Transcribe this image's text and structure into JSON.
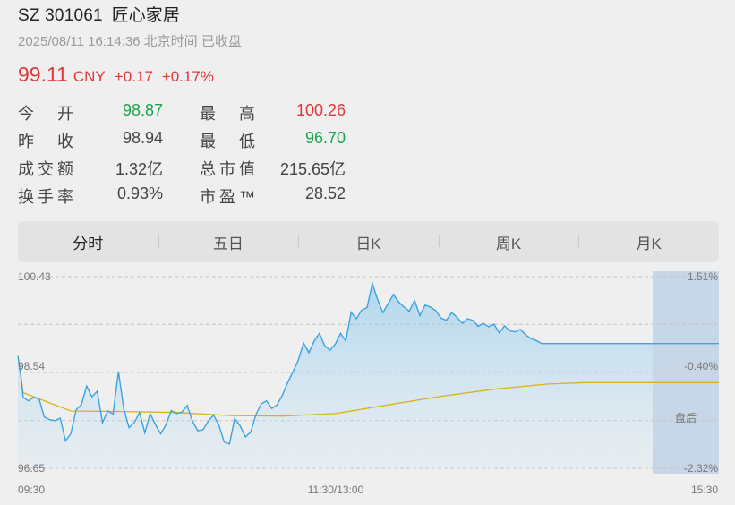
{
  "header": {
    "code": "SZ 301061",
    "name": "匠心家居",
    "timestamp": "2025/08/11 16:14:36 北京时间 已收盘"
  },
  "quote": {
    "price": "99.11",
    "currency": "CNY",
    "change": "+0.17",
    "change_pct": "+0.17%"
  },
  "stats": [
    {
      "l1": "今开",
      "v1": "98.87",
      "c1": "green",
      "l2": "最高",
      "v2": "100.26",
      "c2": "red"
    },
    {
      "l1": "昨收",
      "v1": "98.94",
      "c1": "dark",
      "l2": "最低",
      "v2": "96.70",
      "c2": "green"
    },
    {
      "l1": "成交额",
      "v1": "1.32亿",
      "c1": "dark",
      "l2": "总市值",
      "v2": "215.65亿",
      "c2": "dark"
    },
    {
      "l1": "换手率",
      "v1": "0.93%",
      "c1": "dark",
      "l2": "市盈™",
      "v2": "28.52",
      "c2": "dark"
    }
  ],
  "tabs": [
    "分时",
    "五日",
    "日K",
    "周K",
    "月K"
  ],
  "active_tab": 0,
  "colors": {
    "up": "#e0363a",
    "down": "#1aa34a",
    "price_line": "#3aa3e3",
    "avg_line": "#d9b21a",
    "after_hours": "#b8cde6"
  },
  "chart_data": {
    "type": "line",
    "ylim": [
      96.65,
      100.43
    ],
    "y_ticks_left": [
      "100.43",
      "98.54",
      "96.65"
    ],
    "y_ticks_right": [
      "1.51%",
      "-0.40%",
      "-2.32%"
    ],
    "x_ticks": [
      "09:30",
      "11:30/13:00",
      "15:30"
    ],
    "after_hours_label": "盘后",
    "series": [
      {
        "type": "line",
        "minutes": [
          0,
          1,
          2,
          4,
          6,
          8,
          10,
          12,
          14,
          16,
          18,
          20,
          22,
          24,
          26,
          28,
          30,
          32,
          34,
          36,
          38,
          40,
          42,
          44,
          46,
          48,
          50,
          52,
          54,
          56,
          58,
          60,
          62,
          64,
          66,
          68,
          70,
          72,
          74,
          76,
          78,
          80,
          82,
          84,
          86,
          88,
          90,
          92,
          94,
          96,
          98,
          100,
          102,
          104,
          106,
          108,
          110,
          112,
          114,
          116,
          118,
          120,
          122,
          124,
          126,
          128,
          130,
          132,
          134,
          136,
          138,
          140,
          142,
          144,
          146,
          148,
          150,
          152,
          154,
          156,
          158,
          160,
          162,
          164,
          166,
          168,
          170,
          172,
          174,
          176,
          178,
          180,
          182,
          184,
          186,
          188,
          190,
          192,
          194,
          196,
          198,
          200,
          202,
          204,
          206,
          208,
          210,
          212,
          214,
          216,
          218,
          220,
          222,
          224,
          226,
          228,
          230,
          232,
          234,
          236,
          238,
          240
        ],
        "values": [
          98.86,
          98.53,
          98.05,
          97.98,
          98.05,
          98.02,
          97.66,
          97.61,
          97.59,
          97.64,
          97.19,
          97.33,
          97.8,
          97.91,
          98.27,
          98.06,
          98.17,
          97.55,
          97.78,
          97.72,
          98.56,
          97.83,
          97.45,
          97.55,
          97.75,
          97.35,
          97.73,
          97.51,
          97.33,
          97.51,
          97.79,
          97.73,
          97.76,
          97.89,
          97.58,
          97.39,
          97.41,
          97.58,
          97.7,
          97.5,
          97.17,
          97.13,
          97.63,
          97.49,
          97.27,
          97.36,
          97.71,
          97.92,
          97.98,
          97.83,
          97.9,
          98.09,
          98.34,
          98.55,
          98.78,
          99.12,
          98.93,
          99.16,
          99.31,
          99.07,
          98.98,
          99.1,
          99.31,
          99.16,
          99.73,
          99.6,
          99.77,
          99.82,
          100.3,
          99.98,
          99.72,
          99.9,
          100.08,
          99.93,
          99.83,
          99.75,
          99.96,
          99.66,
          99.87,
          99.83,
          99.76,
          99.61,
          99.57,
          99.72,
          99.63,
          99.51,
          99.6,
          99.57,
          99.45,
          99.51,
          99.44,
          99.49,
          99.32,
          99.46,
          99.36,
          99.34,
          99.39,
          99.28,
          99.21,
          99.17,
          99.11,
          99.11,
          99.11,
          99.11,
          99.11,
          99.11,
          99.11,
          99.11,
          99.11,
          99.11,
          99.11,
          99.11,
          99.11,
          99.11,
          99.11,
          99.11,
          99.11,
          99.11,
          99.11,
          99.11,
          99.11,
          99.11
        ]
      },
      {
        "type": "line",
        "minutes": [
          0,
          2,
          20,
          40,
          60,
          80,
          100,
          120,
          140,
          160,
          180,
          200,
          215,
          240
        ],
        "values": [
          98.87,
          98.14,
          97.78,
          97.77,
          97.75,
          97.69,
          97.68,
          97.73,
          97.9,
          98.07,
          98.21,
          98.31,
          98.34,
          98.34
        ]
      }
    ]
  }
}
